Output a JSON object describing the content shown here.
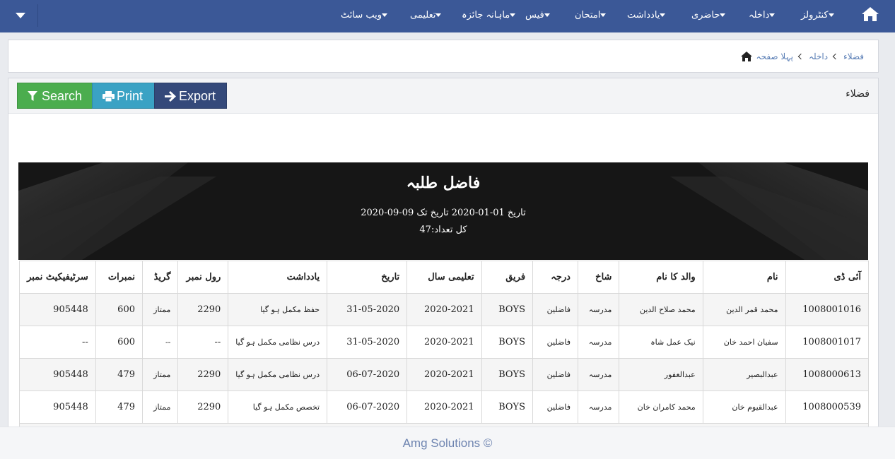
{
  "nav": {
    "items": [
      {
        "label": "کنٹرولز"
      },
      {
        "label": "داخلہ"
      },
      {
        "label": "حاضری"
      },
      {
        "label": "یادداشت"
      },
      {
        "label": "امتحان"
      },
      {
        "label": "فیس"
      },
      {
        "label": "ماہانہ جائزہ"
      },
      {
        "label": "تعلیمی"
      },
      {
        "label": "ویب سائٹ"
      }
    ]
  },
  "breadcrumb": {
    "home": "پہلا صفحہ",
    "level1": "داخلہ",
    "current": "فضلاء"
  },
  "panel": {
    "title": "فضلاء",
    "buttons": {
      "search": "Search",
      "print": "Print",
      "export": "Export"
    }
  },
  "report": {
    "title": "فاضل طلبہ",
    "dates": "تاریخ 01-01-2020 تاریخ تک 09-09-2020",
    "total": "کل تعداد:47",
    "columns": [
      "آئی ڈی",
      "نام",
      "والد کا نام",
      "شاخ",
      "درجہ",
      "فریق",
      "تعلیمی سال",
      "تاریخ",
      "یادداشت",
      "رول نمبر",
      "گریڈ",
      "نمبرات",
      "سرٹیفیکیٹ نمبر"
    ],
    "rows": [
      [
        "1008001016",
        "محمد قمر الدین",
        "محمد صلاح الدین",
        "مدرسہ",
        "فاضلین",
        "BOYS",
        "2020-2021",
        "31-05-2020",
        "حفظ مکمل ہو گیا",
        "2290",
        "ممتاز",
        "600",
        "905448"
      ],
      [
        "1008001017",
        "سفیان احمد خان",
        "نیک عمل شاہ",
        "مدرسہ",
        "فاضلین",
        "BOYS",
        "2020-2021",
        "31-05-2020",
        "درس نظامی مکمل ہو گیا",
        "--",
        "--",
        "600",
        "--"
      ],
      [
        "1008000613",
        "عبدالبصیر",
        "عبدالغفور",
        "مدرسہ",
        "فاضلین",
        "BOYS",
        "2020-2021",
        "06-07-2020",
        "درس نظامی مکمل ہو گیا",
        "2290",
        "ممتاز",
        "479",
        "905448"
      ],
      [
        "1008000539",
        "عبدالقیوم خان",
        "محمد کامران خان",
        "مدرسہ",
        "فاضلین",
        "BOYS",
        "2020-2021",
        "06-07-2020",
        "تخصص مکمل ہو گیا",
        "2290",
        "ممتاز",
        "479",
        "905448"
      ]
    ]
  },
  "footer": {
    "text": "Amg Solutions ©"
  },
  "colors": {
    "navbar": "#3b5897",
    "search_button": "#4bad4e",
    "print_button": "#3aa2c4",
    "export_button": "#34497a",
    "banner": "#161616",
    "link": "#5b7fb6"
  },
  "icons": {
    "nav_home": "home-icon",
    "nav_toggle": "caret-down-icon",
    "breadcrumb_home": "home-icon",
    "search": "filter-icon",
    "print": "print-icon",
    "export": "arrow-right-icon"
  }
}
